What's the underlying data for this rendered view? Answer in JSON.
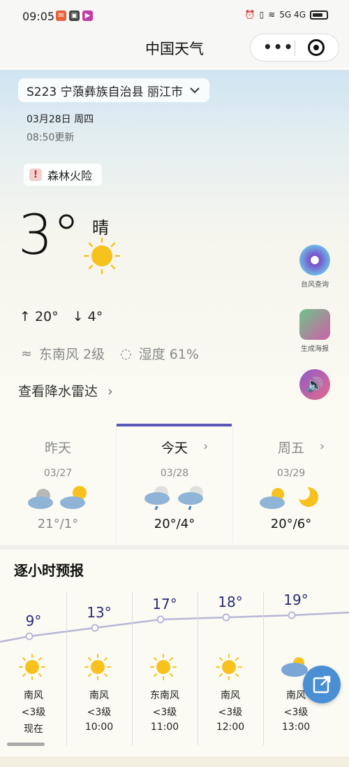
{
  "status_bar": {
    "time": "09:05",
    "network": "5G 4G"
  },
  "header": {
    "title": "中国天气"
  },
  "location": {
    "name": "S223 宁蒗彝族自治县 丽江市"
  },
  "date": "03月28日 周四",
  "updated": "08:50更新",
  "warning": {
    "label": "森林火险",
    "icon": "!"
  },
  "current": {
    "temp": "3°",
    "condition": "晴",
    "high": "20°",
    "low": "4°",
    "wind": "东南风 2级",
    "humidity": "湿度 61%",
    "radar_link": "查看降水雷达"
  },
  "side_buttons": [
    {
      "label": "台风查询",
      "icon": "typhoon-icon"
    },
    {
      "label": "生成海报",
      "icon": "camera-icon"
    },
    {
      "label": "",
      "icon": "speaker-icon"
    }
  ],
  "days": [
    {
      "name": "昨天",
      "date": "03/27",
      "range": "21°/1°"
    },
    {
      "name": "今天",
      "date": "03/28",
      "range": "20°/4°"
    },
    {
      "name": "周五",
      "date": "03/29",
      "range": "20°/6°"
    }
  ],
  "hourly": {
    "title": "逐小时预报",
    "items": [
      {
        "temp": "9°",
        "wind": "南风",
        "level": "<3级",
        "time": "现在",
        "icon": "sun-icon"
      },
      {
        "temp": "13°",
        "wind": "南风",
        "level": "<3级",
        "time": "10:00",
        "icon": "sun-icon"
      },
      {
        "temp": "17°",
        "wind": "东南风",
        "level": "<3级",
        "time": "11:00",
        "icon": "sun-icon"
      },
      {
        "temp": "18°",
        "wind": "南风",
        "level": "<3级",
        "time": "12:00",
        "icon": "sun-icon"
      },
      {
        "temp": "19°",
        "wind": "南风",
        "level": "<3级",
        "time": "13:00",
        "icon": "partly-cloudy-icon"
      }
    ]
  },
  "colors": {
    "accent": "#5b57b8",
    "temp_text": "#2b2a78",
    "curve": "#b8b6d6"
  }
}
